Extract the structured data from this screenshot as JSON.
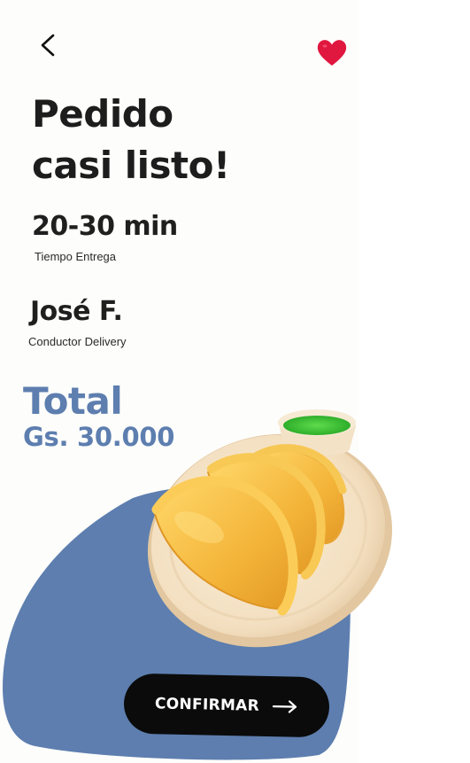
{
  "header": {
    "back_icon": "chevron-left-icon",
    "favorite_icon": "heart-icon",
    "favorite_color": "#e0173f"
  },
  "title": {
    "line1": "Pedido",
    "line2": "casi listo!"
  },
  "delivery_time": {
    "value": "20-30 min",
    "label": "Tiempo Entrega"
  },
  "driver": {
    "name": "José F.",
    "label": "Conductor Delivery"
  },
  "total": {
    "title": "Total",
    "amount": "Gs. 30.000"
  },
  "food_image": {
    "description_icon": "empanadas-plate-icon"
  },
  "confirm": {
    "label": "CONFIRMAR",
    "icon": "arrow-right-icon"
  },
  "colors": {
    "accent": "#5d7eaf",
    "button": "#0b0b0b",
    "heart": "#e0173f",
    "text": "#1d1d1d"
  }
}
